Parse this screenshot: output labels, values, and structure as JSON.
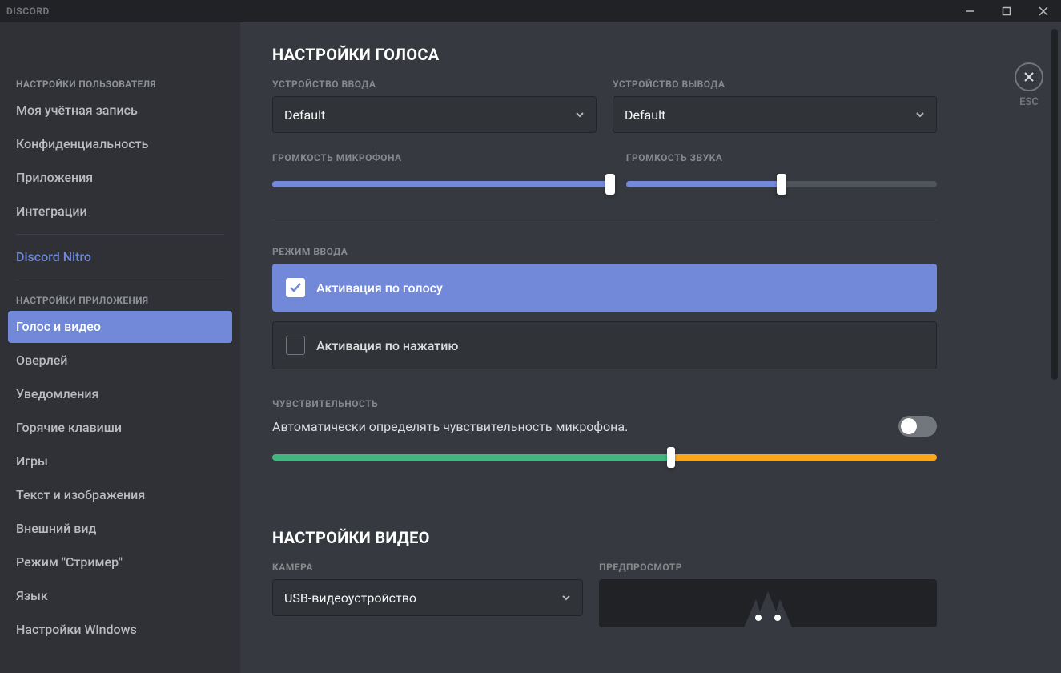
{
  "titlebar": {
    "brand": "DISCORD"
  },
  "close": {
    "esc": "ESC"
  },
  "sidebar": {
    "userHeader": "НАСТРОЙКИ ПОЛЬЗОВАТЕЛЯ",
    "items_user": [
      "Моя учётная запись",
      "Конфиденциальность",
      "Приложения",
      "Интеграции"
    ],
    "nitro": "Discord Nitro",
    "appHeader": "НАСТРОЙКИ ПРИЛОЖЕНИЯ",
    "items_app": [
      "Голос и видео",
      "Оверлей",
      "Уведомления",
      "Горячие клавиши",
      "Игры",
      "Текст и изображения",
      "Внешний вид",
      "Режим \"Стример\"",
      "Язык",
      "Настройки Windows"
    ]
  },
  "voice": {
    "title": "НАСТРОЙКИ ГОЛОСА",
    "inputDeviceLabel": "УСТРОЙСТВО ВВОДА",
    "outputDeviceLabel": "УСТРОЙСТВО ВЫВОДА",
    "inputDevice": "Default",
    "outputDevice": "Default",
    "micVolumeLabel": "ГРОМКОСТЬ МИКРОФОНА",
    "outVolumeLabel": "ГРОМКОСТЬ ЗВУКА",
    "micVolume": 100,
    "outVolume": 50,
    "inputModeLabel": "РЕЖИМ ВВОДА",
    "modeVoice": "Активация по голосу",
    "modePtt": "Активация по нажатию",
    "sensitivityLabel": "ЧУВСТВИТЕЛЬНОСТЬ",
    "autoSensText": "Автоматически определять чувствительность микрофона.",
    "sensitivityValue": 60
  },
  "video": {
    "title": "НАСТРОЙКИ ВИДЕО",
    "cameraLabel": "КАМЕРА",
    "cameraValue": "USB-видеоустройство",
    "previewLabel": "ПРЕДПРОСМОТР"
  }
}
